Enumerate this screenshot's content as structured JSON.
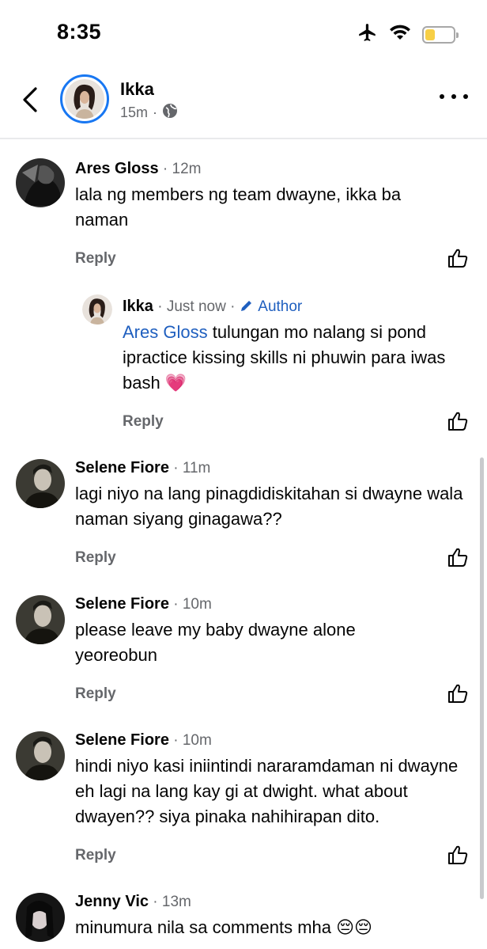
{
  "status": {
    "time": "8:35",
    "icons": [
      "airplane-icon",
      "wifi-icon",
      "battery-icon"
    ]
  },
  "header": {
    "name": "Ikka",
    "time": "15m",
    "separator": "·",
    "privacy_icon": "globe-icon"
  },
  "comments": [
    {
      "name": "Ares Gloss",
      "time": "12m",
      "text": "lala ng members ng team dwayne, ikka ba naman",
      "reply_label": "Reply"
    },
    {
      "name": "Ikka",
      "time": "Just now",
      "author_label": "Author",
      "mention": "Ares Gloss",
      "text": " tulungan mo nalang si pond ipractice kissing skills ni phuwin para iwas bash 💗",
      "reply_label": "Reply"
    },
    {
      "name": "Selene Fiore",
      "time": "11m",
      "text": "lagi niyo na lang pinagdidiskitahan si dwayne wala naman siyang ginagawa??",
      "reply_label": "Reply"
    },
    {
      "name": "Selene Fiore",
      "time": "10m",
      "text": "please leave my baby dwayne alone yeoreobun",
      "reply_label": "Reply"
    },
    {
      "name": "Selene Fiore",
      "time": "10m",
      "text": "hindi niyo kasi iniintindi nararamdaman ni dwayne eh lagi na lang kay gi at dwight. what about dwayen?? siya pinaka nahihirapan dito.",
      "reply_label": "Reply"
    },
    {
      "name": "Jenny Vic",
      "time": "13m",
      "text": "minumura nila sa comments mha 😔😔"
    }
  ],
  "colors": {
    "link": "#1f5fbf",
    "meta": "#65676b",
    "avatar_ring": "#1877f2",
    "battery": "#f7cf46"
  }
}
